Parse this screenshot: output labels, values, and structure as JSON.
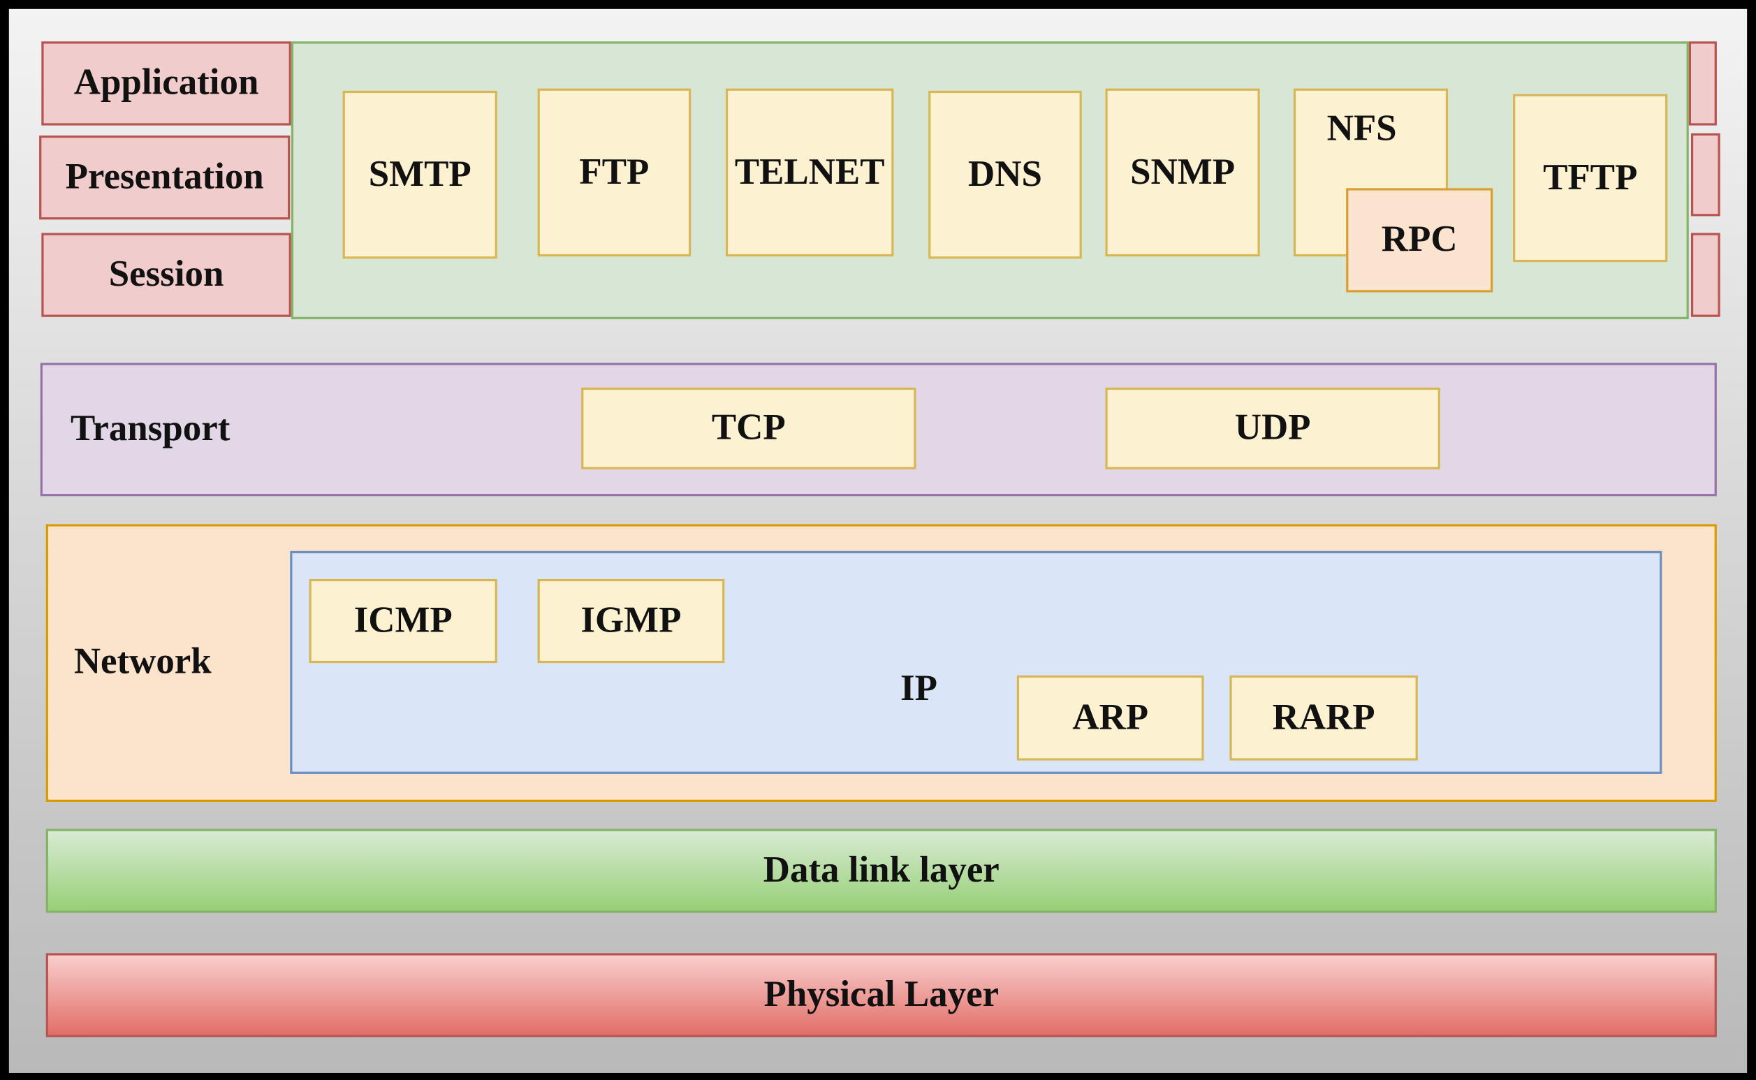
{
  "application_layers": {
    "application": "Application",
    "presentation": "Presentation",
    "session": "Session"
  },
  "app_protocols": {
    "smtp": "SMTP",
    "ftp": "FTP",
    "telnet": "TELNET",
    "dns": "DNS",
    "snmp": "SNMP",
    "nfs": "NFS",
    "rpc": "RPC",
    "tftp": "TFTP"
  },
  "transport": {
    "label": "Transport",
    "tcp": "TCP",
    "udp": "UDP"
  },
  "network": {
    "label": "Network",
    "ip": "IP",
    "icmp": "ICMP",
    "igmp": "IGMP",
    "arp": "ARP",
    "rarp": "RARP"
  },
  "data_link": {
    "label": "Data link layer"
  },
  "physical": {
    "label": "Physical Layer"
  },
  "colors": {
    "app_layer": "#f1cccc",
    "app_group": "#d5e8d4",
    "protocol": "#fcf1d0",
    "transport": "#e1d5e7",
    "network": "#fbe3cc",
    "ip": "#dae8fc"
  }
}
